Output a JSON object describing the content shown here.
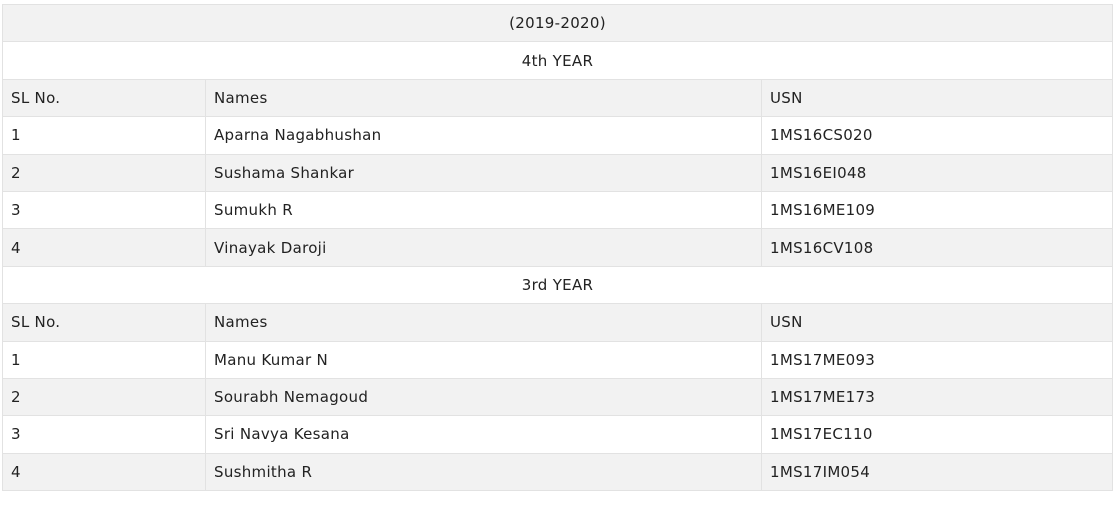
{
  "session": "(2019-2020)",
  "columns": {
    "sl": "SL No.",
    "name": "Names",
    "usn": "USN"
  },
  "sections": [
    {
      "title": "4th YEAR",
      "rows": [
        {
          "sl": "1",
          "name": "Aparna Nagabhushan",
          "usn": "1MS16CS020"
        },
        {
          "sl": "2",
          "name": "Sushama Shankar",
          "usn": "1MS16EI048"
        },
        {
          "sl": "3",
          "name": "Sumukh R",
          "usn": "1MS16ME109"
        },
        {
          "sl": "4",
          "name": "Vinayak Daroji",
          "usn": "1MS16CV108"
        }
      ]
    },
    {
      "title": "3rd YEAR",
      "rows": [
        {
          "sl": "1",
          "name": "Manu Kumar N",
          "usn": "1MS17ME093"
        },
        {
          "sl": "2",
          "name": "Sourabh Nemagoud",
          "usn": "1MS17ME173"
        },
        {
          "sl": "3",
          "name": "Sri Navya Kesana",
          "usn": "1MS17EC110"
        },
        {
          "sl": "4",
          "name": "Sushmitha R",
          "usn": "1MS17IM054"
        }
      ]
    }
  ]
}
